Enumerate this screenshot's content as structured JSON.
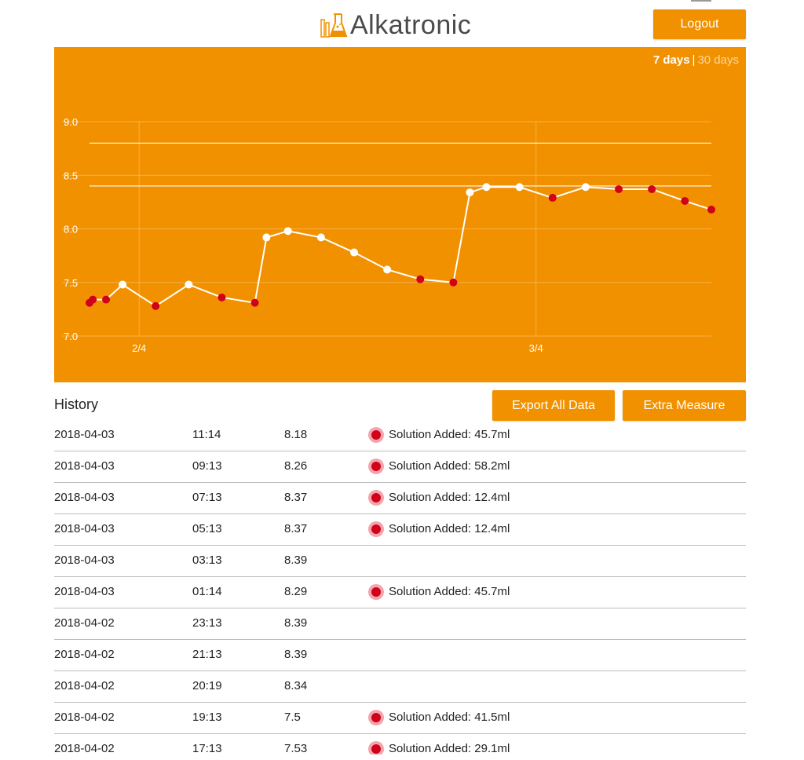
{
  "app": {
    "title": "Alkatronic",
    "logout_label": "Logout"
  },
  "range": {
    "active": "7 days",
    "separator": "|",
    "inactive": "30 days"
  },
  "actions": {
    "export_label": "Export All Data",
    "extra_label": "Extra Measure"
  },
  "history": {
    "title": "History",
    "rows": [
      {
        "date": "2018-04-03",
        "time": "11:14",
        "value": "8.18",
        "note": "Solution Added: 45.7ml"
      },
      {
        "date": "2018-04-03",
        "time": "09:13",
        "value": "8.26",
        "note": "Solution Added: 58.2ml"
      },
      {
        "date": "2018-04-03",
        "time": "07:13",
        "value": "8.37",
        "note": "Solution Added: 12.4ml"
      },
      {
        "date": "2018-04-03",
        "time": "05:13",
        "value": "8.37",
        "note": "Solution Added: 12.4ml"
      },
      {
        "date": "2018-04-03",
        "time": "03:13",
        "value": "8.39",
        "note": ""
      },
      {
        "date": "2018-04-03",
        "time": "01:14",
        "value": "8.29",
        "note": "Solution Added: 45.7ml"
      },
      {
        "date": "2018-04-02",
        "time": "23:13",
        "value": "8.39",
        "note": ""
      },
      {
        "date": "2018-04-02",
        "time": "21:13",
        "value": "8.39",
        "note": ""
      },
      {
        "date": "2018-04-02",
        "time": "20:19",
        "value": "8.34",
        "note": ""
      },
      {
        "date": "2018-04-02",
        "time": "19:13",
        "value": "7.5",
        "note": "Solution Added: 41.5ml"
      },
      {
        "date": "2018-04-02",
        "time": "17:13",
        "value": "7.53",
        "note": "Solution Added: 29.1ml"
      }
    ]
  },
  "chart_data": {
    "type": "line",
    "ylim": [
      7.0,
      9.0
    ],
    "yticks": [
      "7.0",
      "7.5",
      "8.0",
      "8.5",
      "9.0"
    ],
    "xticks": [
      {
        "label": "2/4",
        "x": 2.2
      },
      {
        "label": "3/4",
        "x": 14.2
      }
    ],
    "xlim": [
      0.7,
      19.5
    ],
    "reference_lines": [
      8.4,
      8.8
    ],
    "colors": {
      "background": "#f29100",
      "line": "#ffffff",
      "normal_point": "#ffffff",
      "dosed_point": "#d0021b"
    },
    "series": [
      {
        "points": [
          {
            "x": 0.7,
            "y": 7.31,
            "dosed": true
          },
          {
            "x": 0.8,
            "y": 7.34,
            "dosed": true
          },
          {
            "x": 1.2,
            "y": 7.34,
            "dosed": true
          },
          {
            "x": 1.7,
            "y": 7.48,
            "dosed": false
          },
          {
            "x": 2.7,
            "y": 7.28,
            "dosed": true
          },
          {
            "x": 3.7,
            "y": 7.48,
            "dosed": false
          },
          {
            "x": 4.7,
            "y": 7.36,
            "dosed": true
          },
          {
            "x": 5.7,
            "y": 7.31,
            "dosed": true
          },
          {
            "x": 6.05,
            "y": 7.92,
            "dosed": false
          },
          {
            "x": 6.7,
            "y": 7.98,
            "dosed": false
          },
          {
            "x": 7.7,
            "y": 7.92,
            "dosed": false
          },
          {
            "x": 8.7,
            "y": 7.78,
            "dosed": false
          },
          {
            "x": 9.7,
            "y": 7.62,
            "dosed": false
          },
          {
            "x": 10.7,
            "y": 7.53,
            "dosed": true
          },
          {
            "x": 11.7,
            "y": 7.5,
            "dosed": true
          },
          {
            "x": 12.2,
            "y": 8.34,
            "dosed": false
          },
          {
            "x": 12.7,
            "y": 8.39,
            "dosed": false
          },
          {
            "x": 13.7,
            "y": 8.39,
            "dosed": false
          },
          {
            "x": 14.7,
            "y": 8.29,
            "dosed": true
          },
          {
            "x": 15.7,
            "y": 8.39,
            "dosed": false
          },
          {
            "x": 16.7,
            "y": 8.37,
            "dosed": true
          },
          {
            "x": 17.7,
            "y": 8.37,
            "dosed": true
          },
          {
            "x": 18.7,
            "y": 8.26,
            "dosed": true
          },
          {
            "x": 19.5,
            "y": 8.18,
            "dosed": true
          }
        ]
      }
    ]
  }
}
